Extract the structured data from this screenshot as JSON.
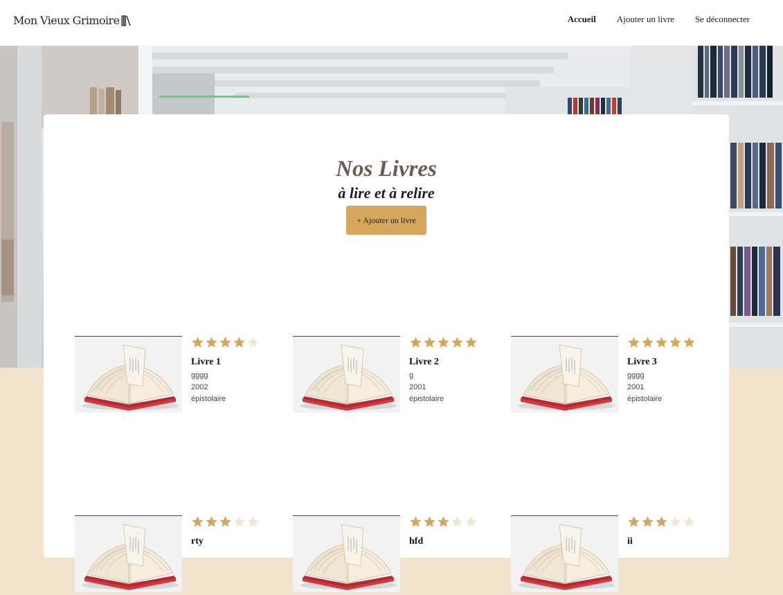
{
  "header": {
    "logo_text": "Mon Vieux Grimoire",
    "nav": [
      {
        "label": "Accueil",
        "active": true
      },
      {
        "label": "Ajouter un livre",
        "active": false
      },
      {
        "label": "Se déconnecter",
        "active": false
      }
    ]
  },
  "main": {
    "title": "Nos Livres",
    "subtitle": "à lire et à relire",
    "add_button": "+ Ajouter un livre"
  },
  "books": [
    {
      "title": "Livre 1",
      "author": "gggg",
      "year": "2002",
      "genre": "épistolaire",
      "rating": 4
    },
    {
      "title": "Livre 2",
      "author": "g",
      "year": "2001",
      "genre": "épistolaire",
      "rating": 5
    },
    {
      "title": "Livre 3",
      "author": "gggg",
      "year": "2001",
      "genre": "épistolaire",
      "rating": 5
    },
    {
      "title": "rty",
      "author": "",
      "year": "",
      "genre": "",
      "rating": 3
    },
    {
      "title": "hfd",
      "author": "",
      "year": "",
      "genre": "",
      "rating": 3
    },
    {
      "title": "ii",
      "author": "",
      "year": "",
      "genre": "",
      "rating": 3
    }
  ],
  "colors": {
    "star_filled": "#d6a65f",
    "star_empty": "#f3e6d3",
    "accent": "#d6a65f",
    "background": "#f1e3cd"
  }
}
